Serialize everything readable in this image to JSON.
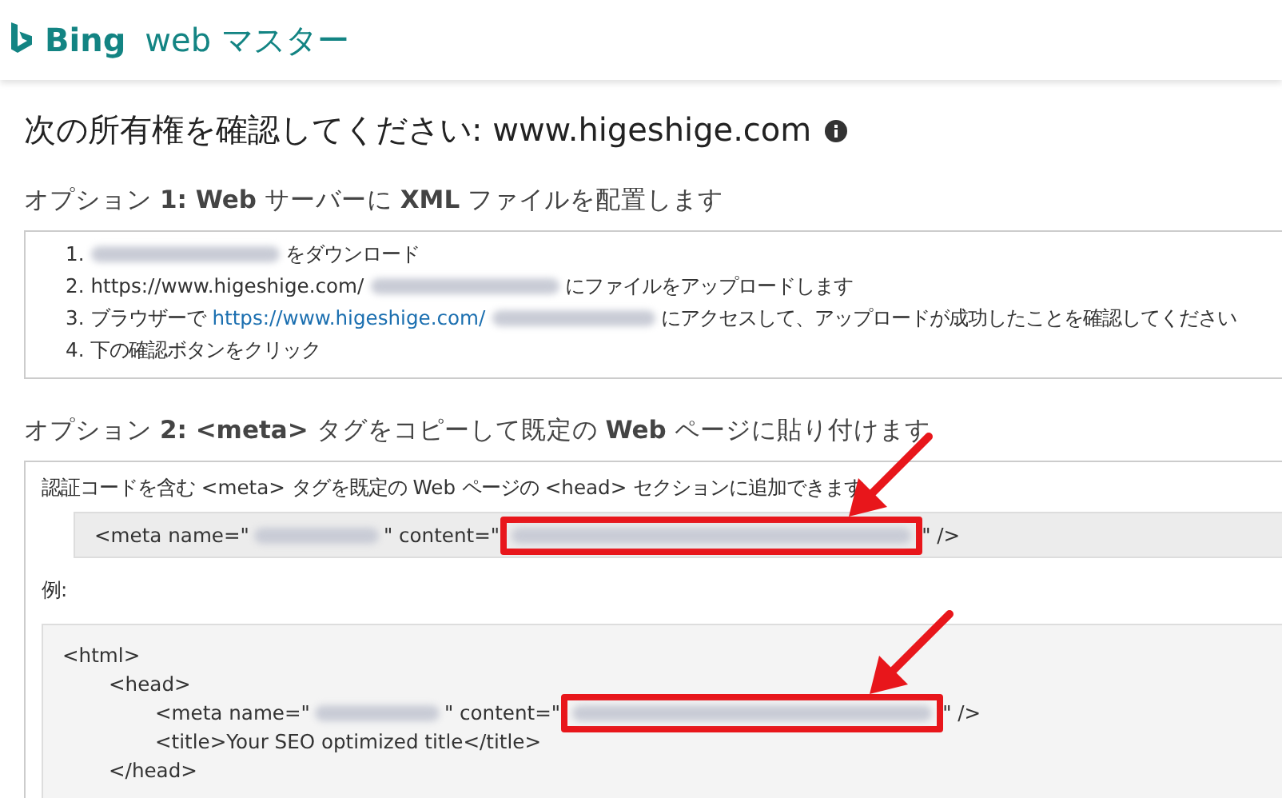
{
  "header": {
    "brand": "Bing",
    "product": "web マスター"
  },
  "title": {
    "text": "次の所有権を確認してください: www.higeshige.com"
  },
  "option1": {
    "heading": "オプション **1: Web** サーバーに **XML** ファイルを配置します",
    "steps": [
      {
        "number": "1.",
        "parts": [
          {
            "kind": "blur"
          },
          {
            "kind": "text",
            "text": "をダウンロード"
          }
        ]
      },
      {
        "number": "2.",
        "parts": [
          {
            "kind": "text",
            "text": "https://www.higeshige.com/"
          },
          {
            "kind": "blur"
          },
          {
            "kind": "text",
            "text": "にファイルをアップロードします"
          }
        ]
      },
      {
        "number": "3.",
        "parts": [
          {
            "kind": "text",
            "text": "ブラウザーで"
          },
          {
            "kind": "link",
            "text": "https://www.higeshige.com/"
          },
          {
            "kind": "blur"
          },
          {
            "kind": "text",
            "text": "にアクセスして、アップロードが成功したことを確認してください"
          }
        ]
      },
      {
        "number": "4.",
        "parts": [
          {
            "kind": "text",
            "text": "下の確認ボタンをクリック"
          }
        ]
      }
    ]
  },
  "option2": {
    "heading": "オプション **2: <meta>** タグをコピーして既定の **Web** ページに貼り付けます",
    "instruction": "認証コードを含む <meta> タグを既定の Web ページの <head> セクションに追加できます",
    "meta_line": [
      {
        "kind": "text",
        "text": "<meta name=\""
      },
      {
        "kind": "blur"
      },
      {
        "kind": "text",
        "text": "\" content=\""
      },
      {
        "kind": "blur",
        "highlighted": true
      },
      {
        "kind": "text",
        "text": "\" />"
      }
    ],
    "example_label": "例:",
    "example": [
      {
        "parts": [
          {
            "kind": "text",
            "text": "<html>"
          }
        ],
        "children": [
          {
            "parts": [
              {
                "kind": "text",
                "text": "<head>"
              }
            ],
            "children": [
              {
                "parts": [
                  {
                    "kind": "text",
                    "text": "<meta name=\""
                  },
                  {
                    "kind": "blur"
                  },
                  {
                    "kind": "text",
                    "text": "\" content=\""
                  },
                  {
                    "kind": "blur",
                    "highlighted": true
                  },
                  {
                    "kind": "text",
                    "text": "\" />"
                  }
                ]
              },
              {
                "parts": [
                  {
                    "kind": "text",
                    "text": "<title>Your SEO optimized title</title>"
                  }
                ]
              }
            ]
          },
          {
            "parts": [
              {
                "kind": "text",
                "text": "</head>"
              }
            ]
          }
        ]
      }
    ]
  }
}
